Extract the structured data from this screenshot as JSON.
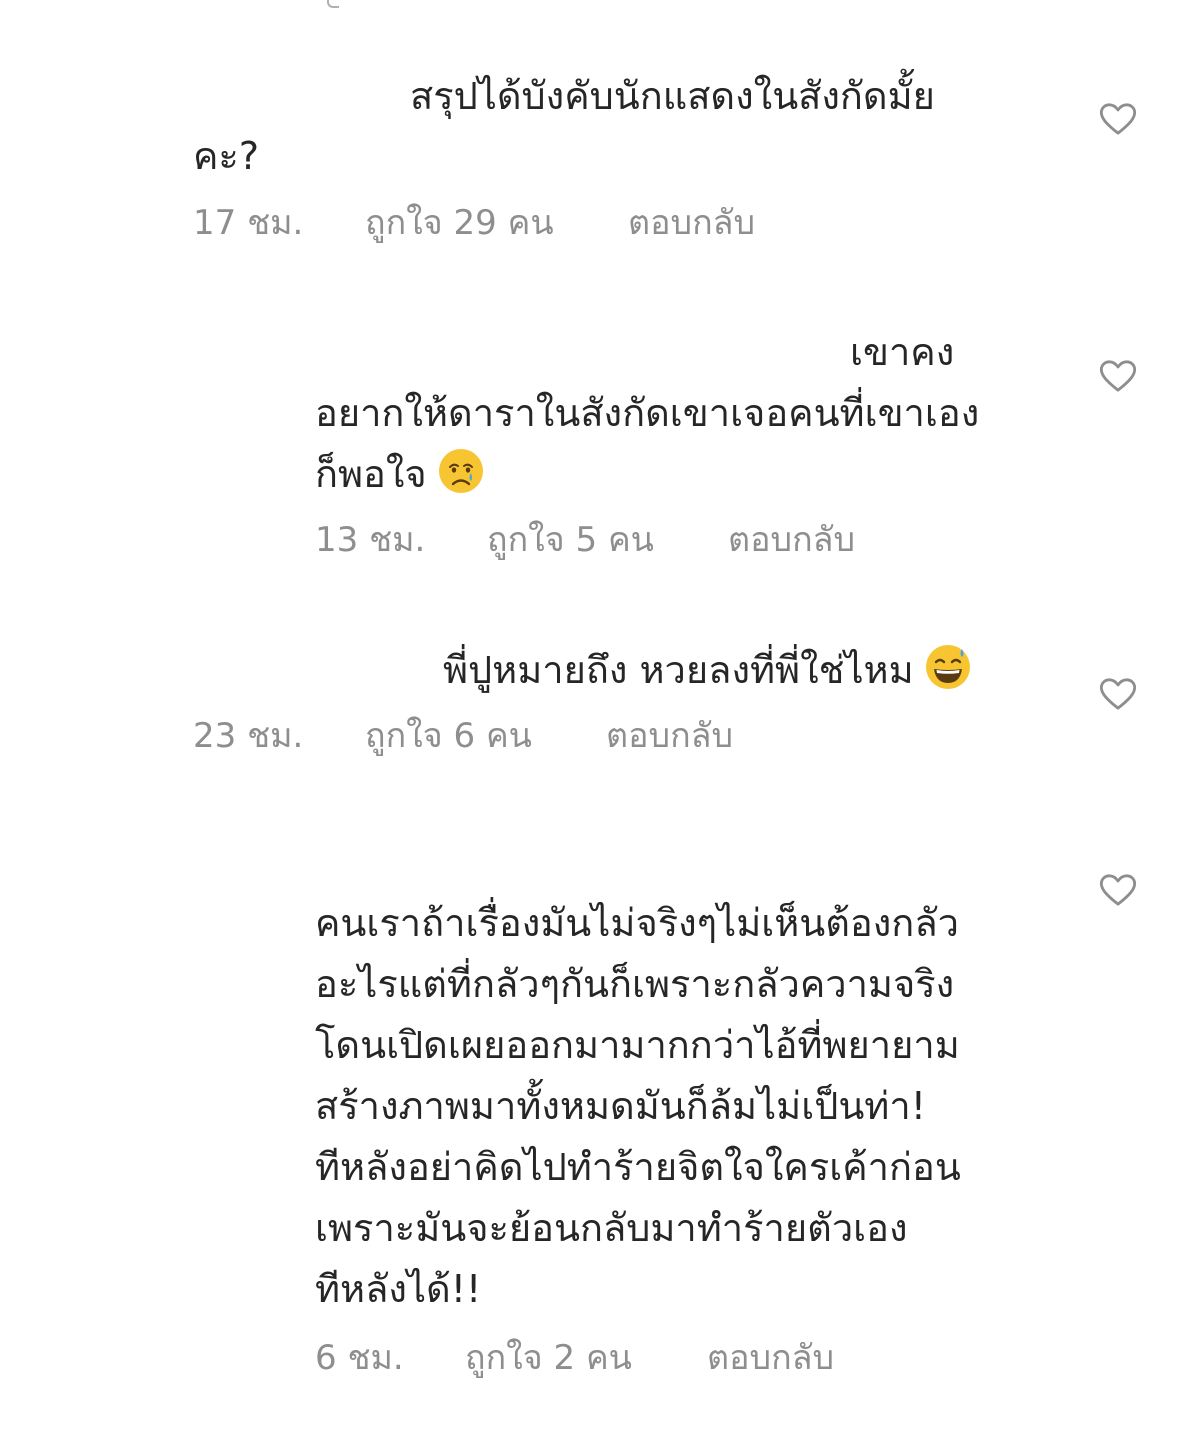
{
  "comments": [
    {
      "lines": [
        "สรุปได้บังคับนักแสดงในสังกัดมั้ย",
        "คะ?"
      ],
      "time": "17 ชม.",
      "likes": "ถูกใจ 29 คน",
      "reply": "ตอบกลับ"
    },
    {
      "lines": [
        "เขาคง",
        "อยากให้ดาราในสังกัดเขาเจอคนที่เขาเอง",
        "ก็พอใจ"
      ],
      "emoji": "crying-face-emoji",
      "time": "13 ชม.",
      "likes": "ถูกใจ 5 คน",
      "reply": "ตอบกลับ"
    },
    {
      "lines": [
        "พี่ปูหมายถึง หวยลงที่พี่ใช่ไหม"
      ],
      "emoji": "grinning-sweat-emoji",
      "time": "23 ชม.",
      "likes": "ถูกใจ 6 คน",
      "reply": "ตอบกลับ"
    },
    {
      "lines": [
        "คนเราถ้าเรื่องมันไม่จริงๆไม่เห็นต้องกลัว",
        "อะไรแต่ที่กลัวๆกันก็เพราะกลัวความจริง",
        "โดนเปิดเผยออกมามากกว่าไอ้ที่พยายาม",
        "สร้างภาพมาทั้งหมดมันก็ล้มไม่เป็นท่า!",
        "ทีหลังอย่าคิดไปทำร้ายจิตใจใครเค้าก่อน",
        "เพราะมันจะย้อนกลับมาทำร้ายตัวเอง",
        "ทีหลังได้!!"
      ],
      "time": "6 ชม.",
      "likes": "ถูกใจ 2 คน",
      "reply": "ตอบกลับ"
    }
  ],
  "colors": {
    "text": "#262626",
    "meta": "#8e8e8e",
    "heart_outline": "#8e8e8e"
  },
  "icons": {
    "like": "heart-outline-icon"
  }
}
